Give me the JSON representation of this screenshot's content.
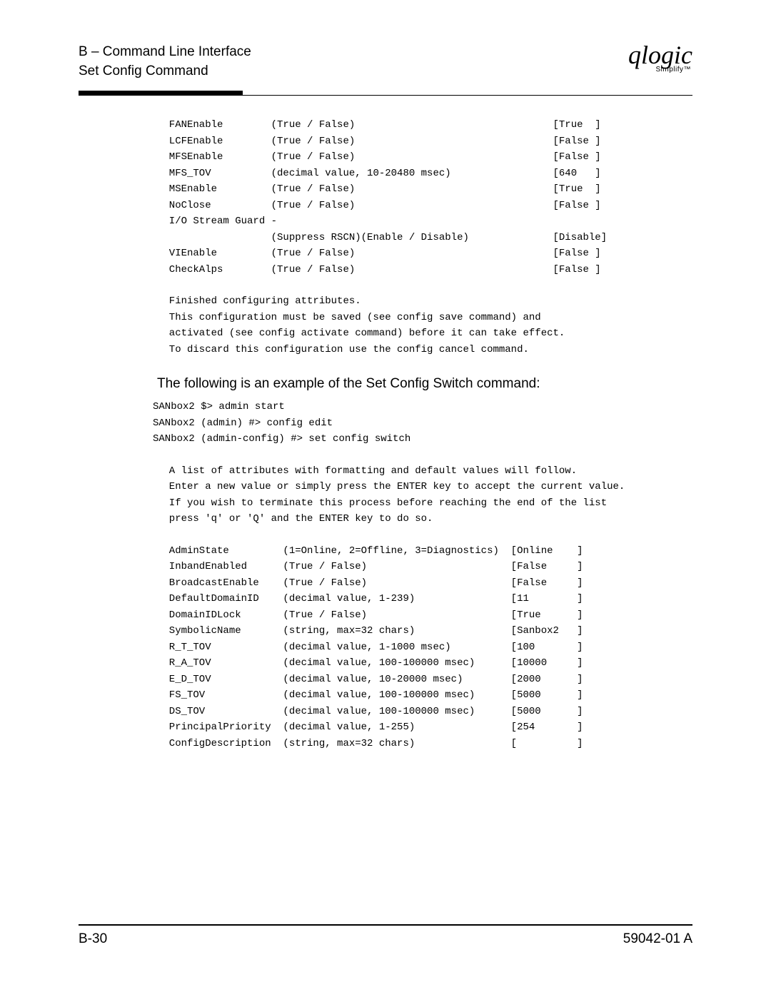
{
  "header": {
    "breadcrumb": "B – Command Line Interface",
    "section": "Set Config Command",
    "brand": "qlogic",
    "brand_sub": "Simplify™"
  },
  "port_cfg": {
    "rows": [
      {
        "name": "FANEnable",
        "format": "(True / False)",
        "value": "[True  ]"
      },
      {
        "name": "LCFEnable",
        "format": "(True / False)",
        "value": "[False ]"
      },
      {
        "name": "MFSEnable",
        "format": "(True / False)",
        "value": "[False ]"
      },
      {
        "name": "MFS_TOV",
        "format": "(decimal value, 10-20480 msec)",
        "value": "[640   ]"
      },
      {
        "name": "MSEnable",
        "format": "(True / False)",
        "value": "[True  ]"
      },
      {
        "name": "NoClose",
        "format": "(True / False)",
        "value": "[False ]"
      },
      {
        "name": "I/O Stream Guard -",
        "format": "",
        "value": ""
      },
      {
        "name": "",
        "format": "(Suppress RSCN)(Enable / Disable)",
        "value": "[Disable]"
      },
      {
        "name": "VIEnable",
        "format": "(True / False)",
        "value": "[False ]"
      },
      {
        "name": "CheckAlps",
        "format": "(True / False)",
        "value": "[False ]"
      }
    ],
    "finish": [
      "Finished configuring attributes.",
      "This configuration must be saved (see config save command) and",
      "activated (see config activate command) before it can take effect.",
      "To discard this configuration use the config cancel command."
    ]
  },
  "intro2": "The following is an example of the Set Config Switch command:",
  "cmds": [
    "SANbox2 $> admin start",
    "SANbox2 (admin) #> config edit",
    "SANbox2 (admin-config) #> set config switch"
  ],
  "preface2": [
    "A list of attributes with formatting and default values will follow.",
    "Enter a new value or simply press the ENTER key to accept the current value.",
    "If you wish to terminate this process before reaching the end of the list",
    "press 'q' or 'Q' and the ENTER key to do so."
  ],
  "switch_cfg": {
    "rows": [
      {
        "name": "AdminState",
        "format": "(1=Online, 2=Offline, 3=Diagnostics)",
        "value": "[Online    ]"
      },
      {
        "name": "InbandEnabled",
        "format": "(True / False)",
        "value": "[False     ]"
      },
      {
        "name": "BroadcastEnable",
        "format": "(True / False)",
        "value": "[False     ]"
      },
      {
        "name": "DefaultDomainID",
        "format": "(decimal value, 1-239)",
        "value": "[11        ]"
      },
      {
        "name": "DomainIDLock",
        "format": "(True / False)",
        "value": "[True      ]"
      },
      {
        "name": "SymbolicName",
        "format": "(string, max=32 chars)",
        "value": "[Sanbox2   ]"
      },
      {
        "name": "R_T_TOV",
        "format": "(decimal value, 1-1000 msec)",
        "value": "[100       ]"
      },
      {
        "name": "R_A_TOV",
        "format": "(decimal value, 100-100000 msec)",
        "value": "[10000     ]"
      },
      {
        "name": "E_D_TOV",
        "format": "(decimal value, 10-20000 msec)",
        "value": "[2000      ]"
      },
      {
        "name": "FS_TOV",
        "format": "(decimal value, 100-100000 msec)",
        "value": "[5000      ]"
      },
      {
        "name": "DS_TOV",
        "format": "(decimal value, 100-100000 msec)",
        "value": "[5000      ]"
      },
      {
        "name": "PrincipalPriority",
        "format": "(decimal value, 1-255)",
        "value": "[254       ]"
      },
      {
        "name": "ConfigDescription",
        "format": "(string, max=32 chars)",
        "value": "[          ]"
      }
    ]
  },
  "footer": {
    "left": "B-30",
    "right": "59042-01 A"
  }
}
